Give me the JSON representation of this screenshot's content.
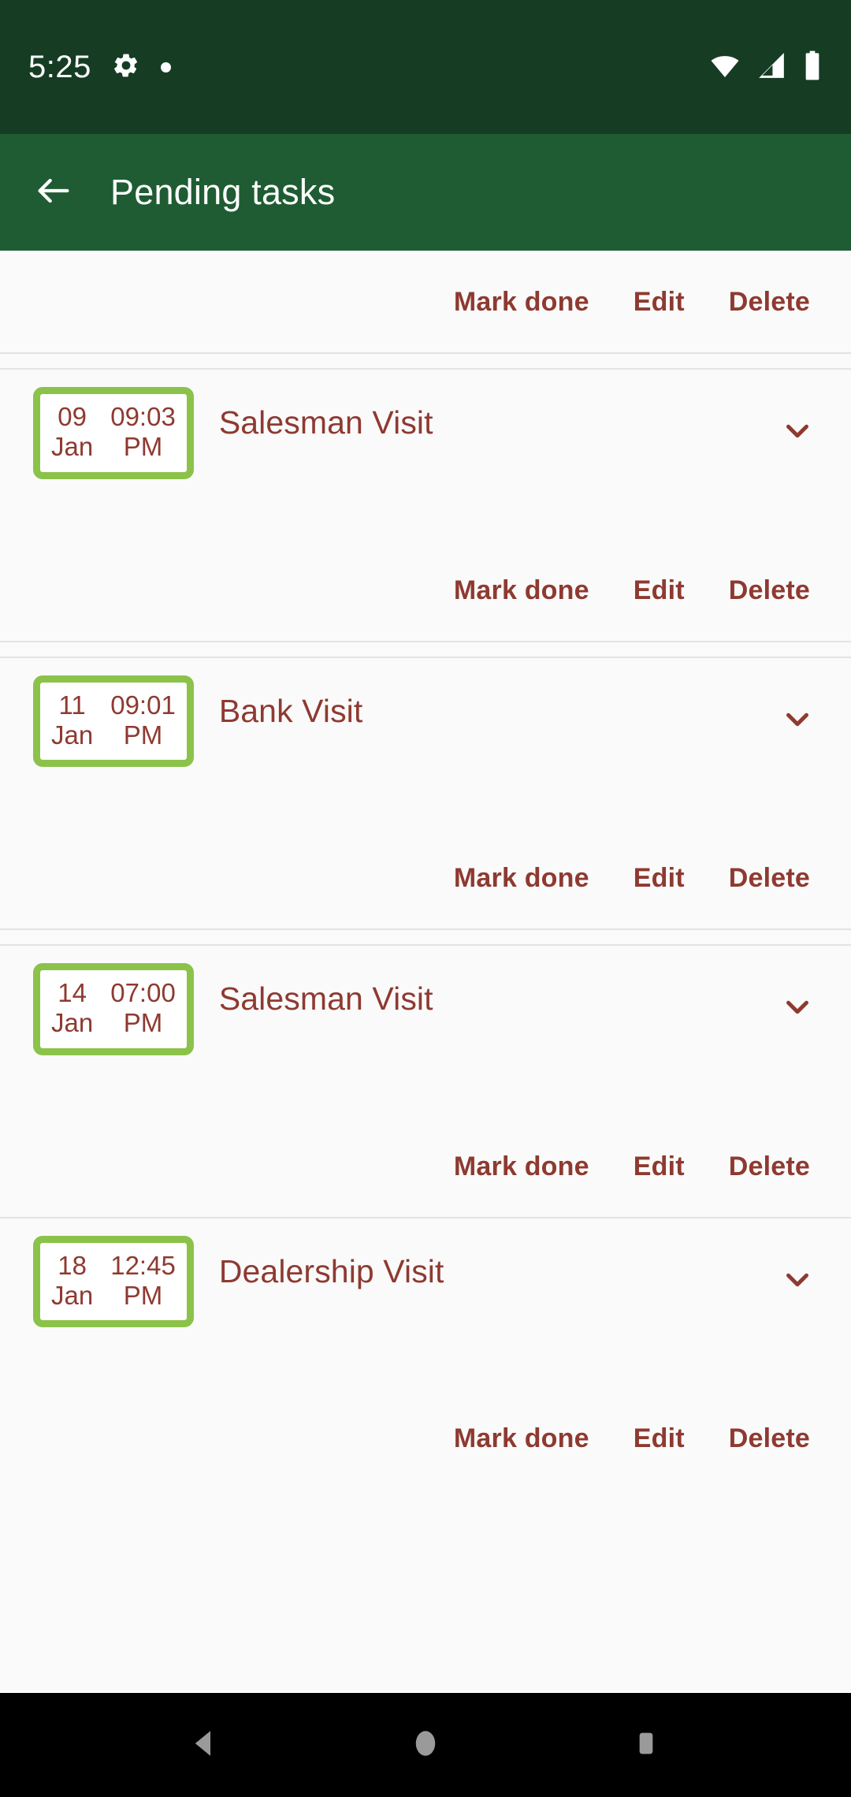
{
  "status_bar": {
    "clock": "5:25",
    "icons_left": [
      "gear-icon",
      "dot-indicator"
    ],
    "icons_right": [
      "wifi-icon",
      "cellular-signal-icon",
      "battery-icon"
    ],
    "background": "#163D24"
  },
  "app_bar": {
    "title": "Pending tasks",
    "back_icon": "arrow-left-icon",
    "background": "#1F5C33",
    "text_color": "#FFFFFF"
  },
  "theme": {
    "accent_red": "#8E3A31",
    "badge_green": "#8BC34A",
    "content_background": "#FAFAFA",
    "divider": "#E3E3E3"
  },
  "actions": {
    "mark_done": "Mark done",
    "edit": "Edit",
    "delete": "Delete"
  },
  "tasks": [
    {
      "day": "09",
      "month": "Jan",
      "time": "09:03",
      "meridiem": "PM",
      "title": "Salesman Visit",
      "expand_icon": "chevron-down-icon"
    },
    {
      "day": "11",
      "month": "Jan",
      "time": "09:01",
      "meridiem": "PM",
      "title": "Bank Visit",
      "expand_icon": "chevron-down-icon"
    },
    {
      "day": "14",
      "month": "Jan",
      "time": "07:00",
      "meridiem": "PM",
      "title": "Salesman Visit",
      "expand_icon": "chevron-down-icon"
    },
    {
      "day": "18",
      "month": "Jan",
      "time": "12:45",
      "meridiem": "PM",
      "title": "Dealership Visit",
      "expand_icon": "chevron-down-icon"
    }
  ],
  "nav_bar": {
    "back": "back-triangle-icon",
    "home": "home-circle-icon",
    "recents": "recents-square-icon",
    "background": "#000000"
  }
}
